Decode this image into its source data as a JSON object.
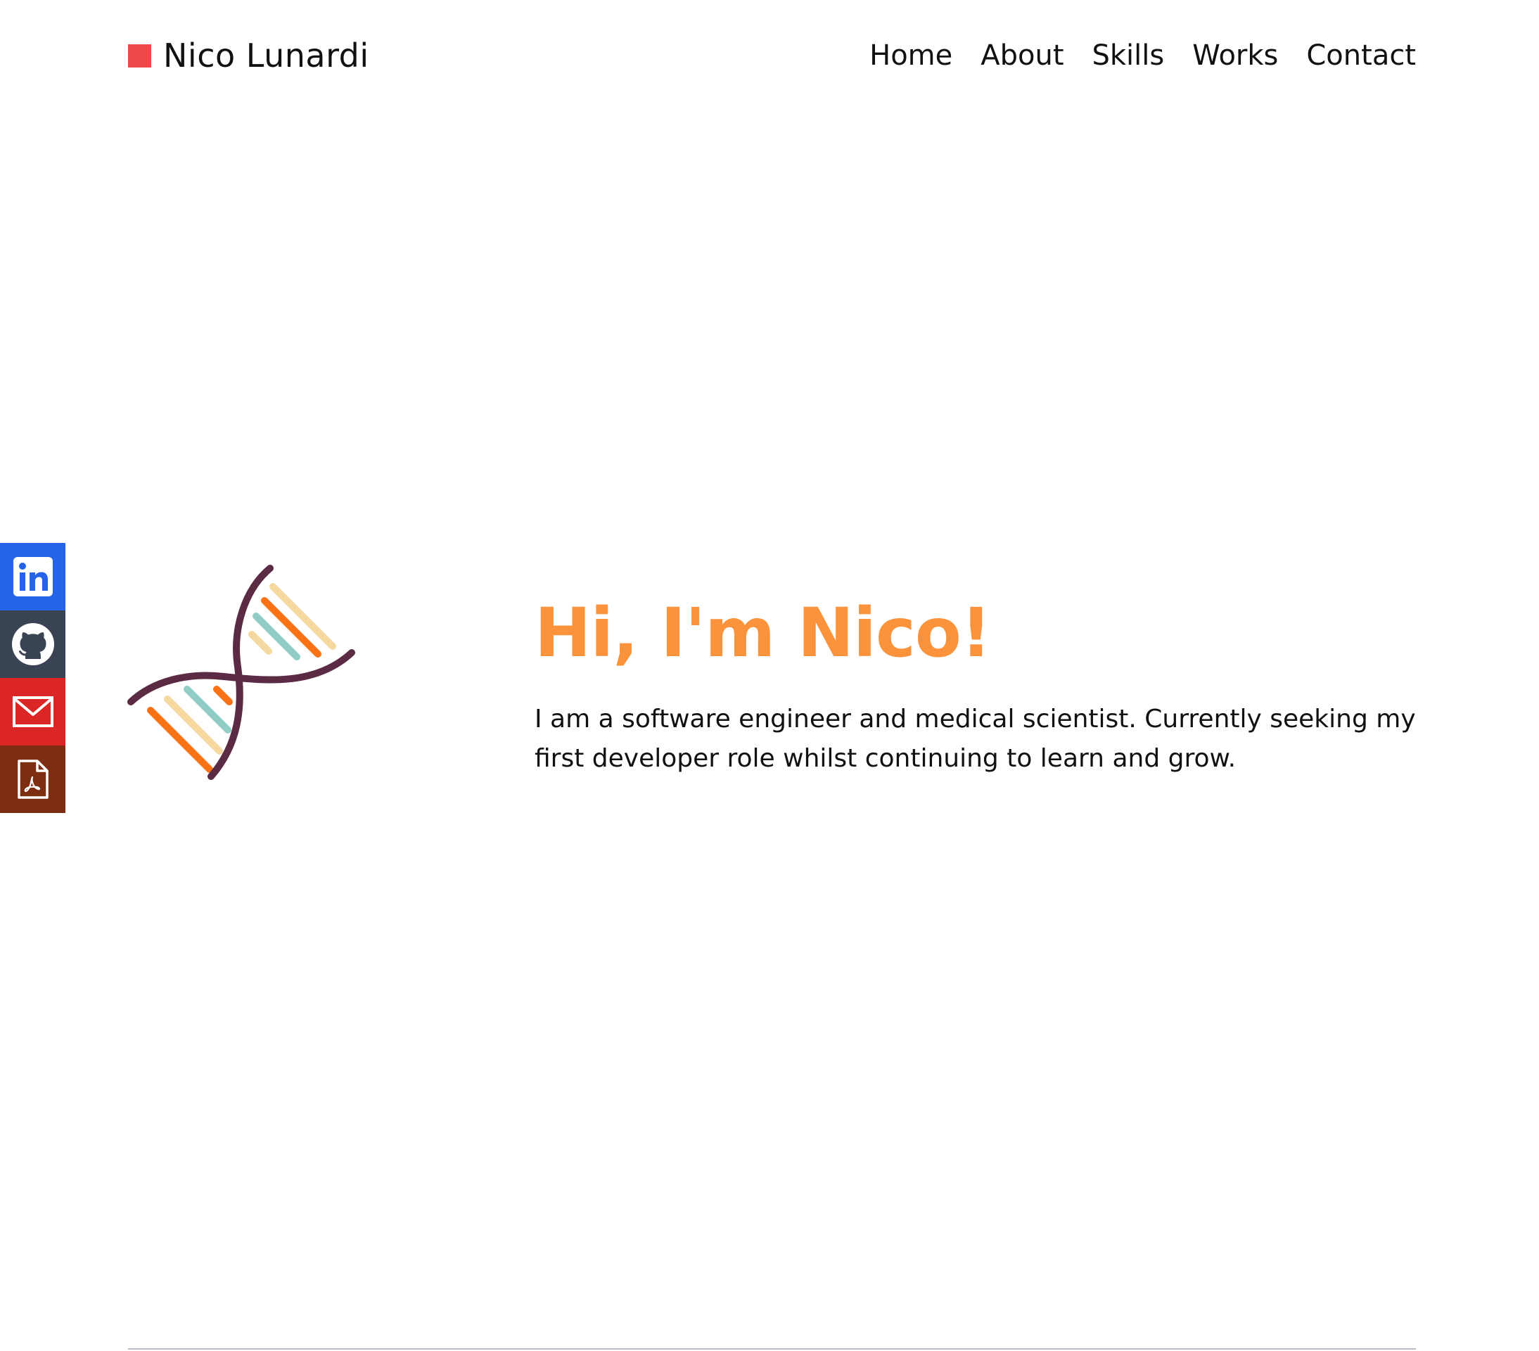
{
  "header": {
    "brand_name": "Nico Lunardi",
    "brand_color": "#f04848",
    "nav": [
      {
        "label": "Home"
      },
      {
        "label": "About"
      },
      {
        "label": "Skills"
      },
      {
        "label": "Works"
      },
      {
        "label": "Contact"
      }
    ]
  },
  "social": [
    {
      "icon": "linkedin-icon",
      "color": "#2563e8"
    },
    {
      "icon": "github-icon",
      "color": "#394354"
    },
    {
      "icon": "email-icon",
      "color": "#dc2626"
    },
    {
      "icon": "pdf-resume-icon",
      "color": "#7c2d12"
    }
  ],
  "hero": {
    "illustration": "dna-helix-icon",
    "title": "Hi, I'm Nico!",
    "title_color": "#fb923c",
    "description": "I am a software engineer and medical scientist. Currently seeking my first developer role whilst continuing to learn and grow."
  }
}
